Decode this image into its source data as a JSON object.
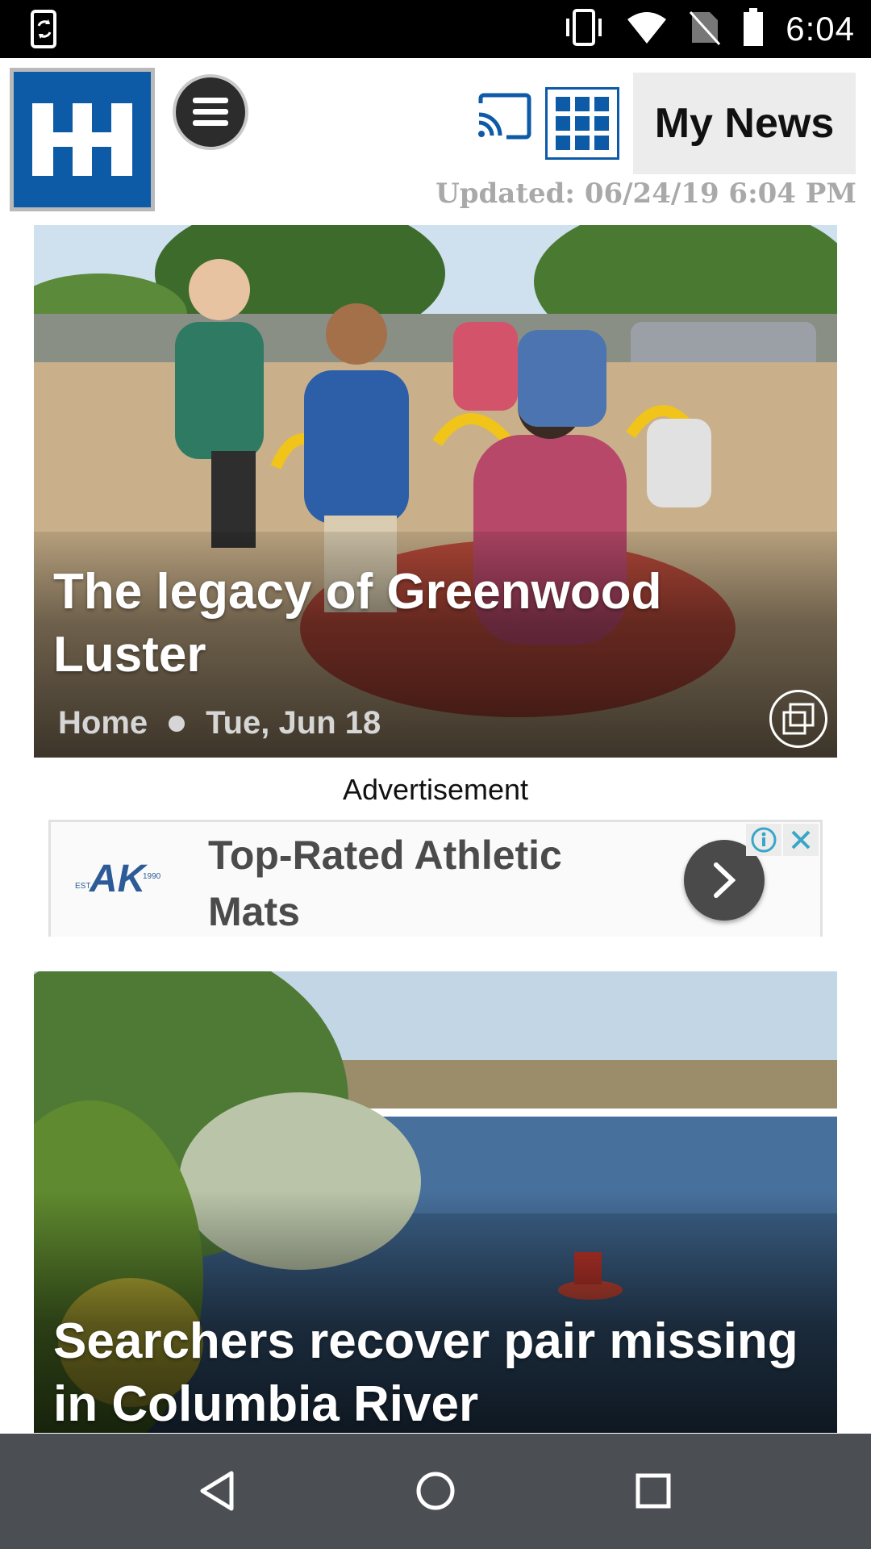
{
  "status_bar": {
    "time": "6:04",
    "icons": [
      "screen-rotate-icon",
      "vibrate-icon",
      "wifi-icon",
      "no-sim-icon",
      "battery-icon"
    ]
  },
  "header": {
    "logo_icon": "hh-logo",
    "menu_icon": "hamburger-icon",
    "cast_icon": "cast-icon",
    "grid_icon": "app-grid-icon",
    "my_news_label": "My News",
    "updated_text": "Updated: 06/24/19 6:04 PM",
    "brand_color": "#0d5aa7"
  },
  "stories": [
    {
      "headline": "The legacy of Greenwood Luster",
      "section": "Home",
      "date": "Tue, Jun 18",
      "gallery_icon": "gallery-icon"
    },
    {
      "headline": "Searchers recover pair missing in Columbia River"
    }
  ],
  "advertisement": {
    "label": "Advertisement",
    "headline": "Top-Rated Athletic Mats",
    "advertiser_logo": "AK",
    "logo_est": "EST.",
    "logo_year": "1990",
    "arrow_icon": "chevron-right-icon",
    "info_icon": "adchoices-info-icon",
    "close_icon": "close-icon"
  },
  "nav_bar": {
    "back_icon": "back-triangle-icon",
    "home_icon": "home-circle-icon",
    "recents_icon": "recents-square-icon"
  }
}
